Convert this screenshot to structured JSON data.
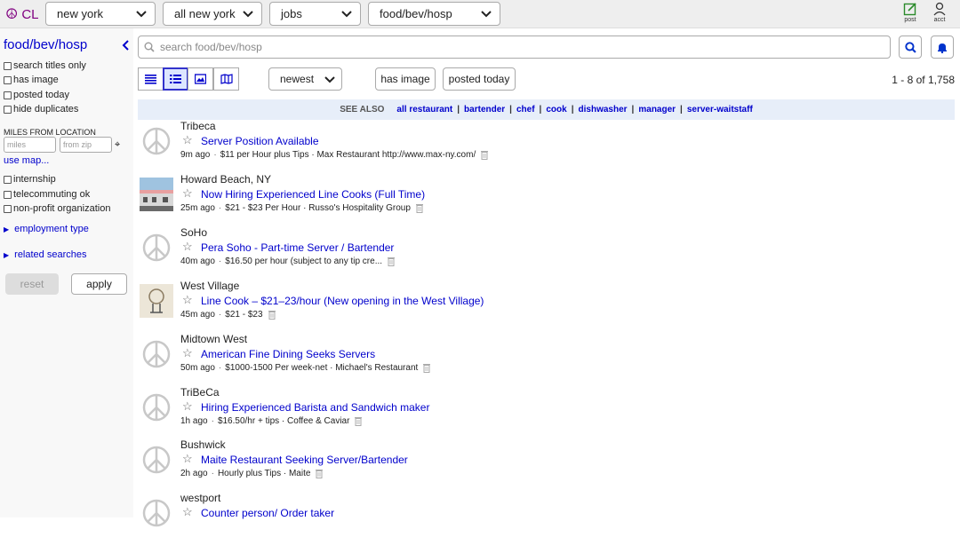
{
  "brand": {
    "logo_text": "CL",
    "logo_icon": "peace-sign-icon"
  },
  "topbar": {
    "area": "new york",
    "subarea": "all new york",
    "section": "jobs",
    "category": "food/bev/hosp",
    "post_label": "post",
    "acct_label": "acct"
  },
  "sidebar": {
    "title": "food/bev/hosp",
    "filters": [
      "search titles only",
      "has image",
      "posted today",
      "hide duplicates"
    ],
    "miles_label": "MILES FROM LOCATION",
    "miles_placeholder": "miles",
    "zip_placeholder": "from zip",
    "use_map": "use map...",
    "extra_filters": [
      "internship",
      "telecommuting ok",
      "non-profit organization"
    ],
    "employment_type": "employment type",
    "related_searches": "related searches",
    "reset": "reset",
    "apply": "apply"
  },
  "search": {
    "placeholder": "search food/bev/hosp"
  },
  "toolbar": {
    "sort": "newest",
    "has_image": "has image",
    "posted_today": "posted today",
    "range": "1 - 8 of 1,758"
  },
  "see_also": {
    "label": "SEE ALSO",
    "links": [
      "all restaurant",
      "bartender",
      "chef",
      "cook",
      "dishwasher",
      "manager",
      "server-waitstaff"
    ]
  },
  "results": [
    {
      "location": "Tribeca",
      "title": "Server Position Available",
      "age": "9m ago",
      "details": "$11 per Hour plus Tips · Max Restaurant http://www.max-ny.com/",
      "thumb": "peace"
    },
    {
      "location": "Howard Beach, NY",
      "title": "Now Hiring Experienced Line Cooks (Full Time)",
      "age": "25m ago",
      "details": "$21 - $23 Per Hour · Russo's Hospitality Group",
      "thumb": "photo-building"
    },
    {
      "location": "SoHo",
      "title": "Pera Soho - Part-time Server / Bartender",
      "age": "40m ago",
      "details": "$16.50 per hour (subject to any tip cre...",
      "thumb": "peace"
    },
    {
      "location": "West Village",
      "title": "Line Cook – $21–23/hour (New opening in the West Village)",
      "age": "45m ago",
      "details": "$21 - $23",
      "thumb": "photo-sign"
    },
    {
      "location": "Midtown West",
      "title": "American Fine Dining Seeks Servers",
      "age": "50m ago",
      "details": "$1000-1500 Per week-net · Michael's Restaurant",
      "thumb": "peace"
    },
    {
      "location": "TriBeCa",
      "title": "Hiring Experienced Barista and Sandwich maker",
      "age": "1h ago",
      "details": "$16.50/hr + tips · Coffee & Caviar",
      "thumb": "peace"
    },
    {
      "location": "Bushwick",
      "title": "Maite Restaurant Seeking Server/Bartender",
      "age": "2h ago",
      "details": "Hourly plus Tips · Maite",
      "thumb": "peace"
    },
    {
      "location": "westport",
      "title": "Counter person/ Order taker",
      "age": "",
      "details": "",
      "thumb": "peace"
    }
  ]
}
